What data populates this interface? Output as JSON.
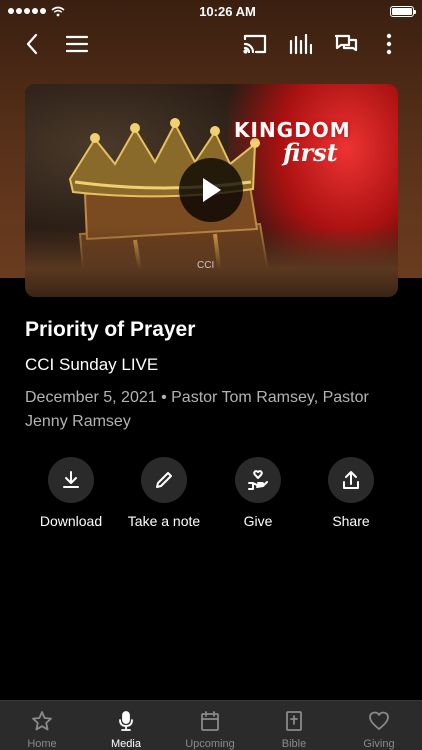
{
  "status_bar": {
    "time": "10:26 AM",
    "signal_dots": 5,
    "battery_level": 1.0
  },
  "header": {
    "icons": [
      "back-icon",
      "menu-icon",
      "cast-icon",
      "audio-icon",
      "chat-icon",
      "more-icon"
    ]
  },
  "artwork": {
    "title": "KINGDOM",
    "subtitle": "first",
    "watermark": "CCI",
    "play_icon": "play-icon"
  },
  "content": {
    "title": "Priority of Prayer",
    "series": "CCI Sunday LIVE",
    "meta": "December 5, 2021 • Pastor Tom Ramsey, Pastor Jenny Ramsey"
  },
  "actions": [
    {
      "label": "Download",
      "icon": "download-icon"
    },
    {
      "label": "Take a note",
      "icon": "pencil-icon"
    },
    {
      "label": "Give",
      "icon": "give-icon"
    },
    {
      "label": "Share",
      "icon": "share-icon"
    }
  ],
  "tabs": [
    {
      "label": "Home",
      "icon": "star-icon",
      "active": false
    },
    {
      "label": "Media",
      "icon": "microphone-icon",
      "active": true
    },
    {
      "label": "Upcoming",
      "icon": "calendar-icon",
      "active": false
    },
    {
      "label": "Bible",
      "icon": "bible-icon",
      "active": false
    },
    {
      "label": "Giving",
      "icon": "heart-icon",
      "active": false
    }
  ],
  "colors": {
    "background": "#000000",
    "header_brown": "#5a321a",
    "tabbar": "#2b2b2b",
    "meta_text": "#b3b3b3"
  }
}
